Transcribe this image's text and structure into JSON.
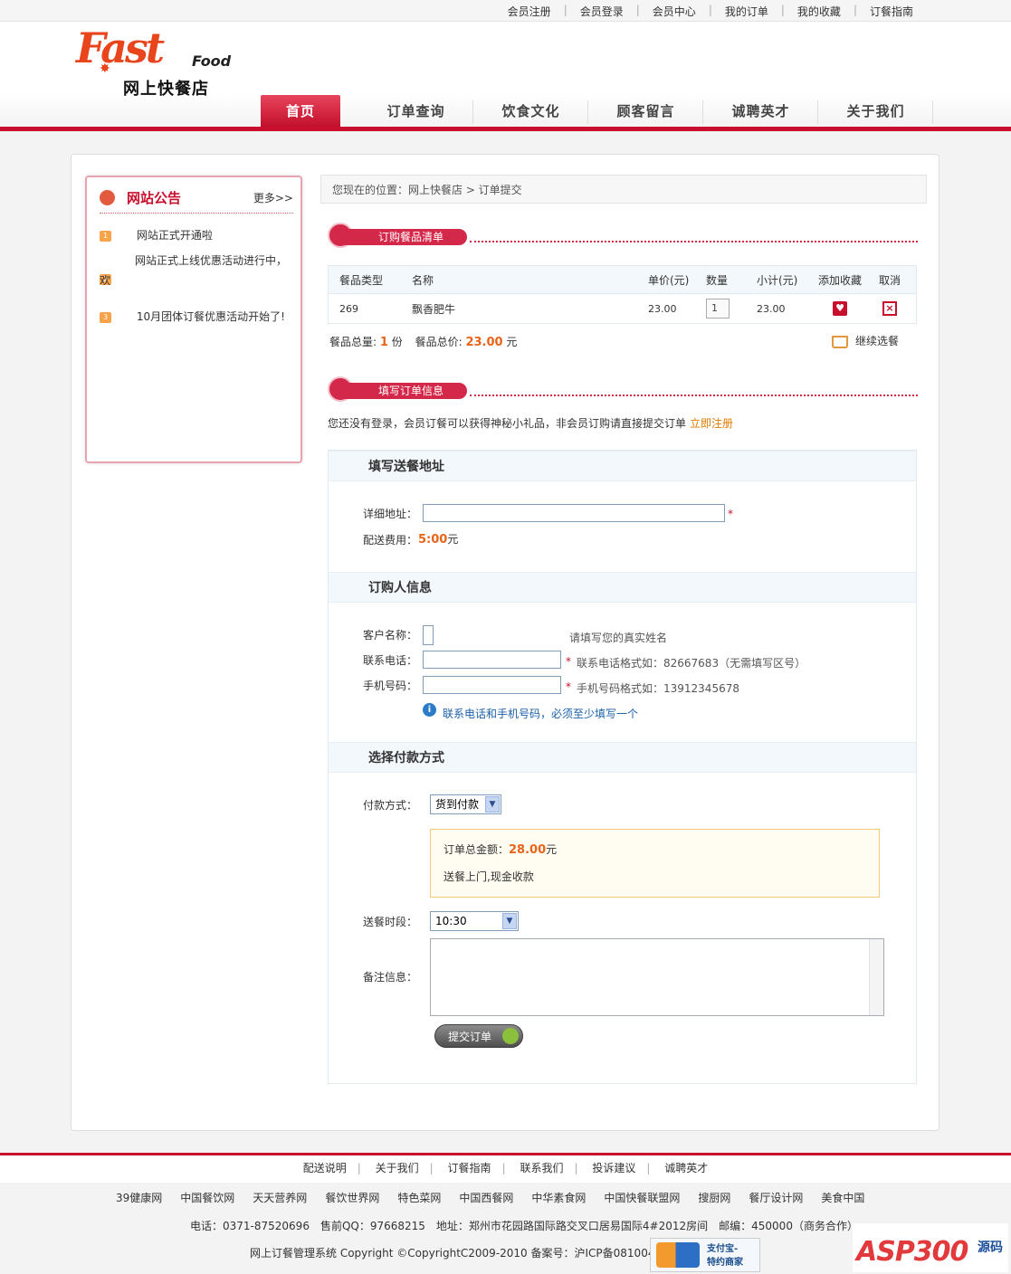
{
  "top_links": [
    "会员注册",
    "会员登录",
    "会员中心",
    "我的订单",
    "我的收藏",
    "订餐指南"
  ],
  "logo": {
    "brand_top": "Fast",
    "brand_food": "Food",
    "brand_cn": "网上快餐店"
  },
  "nav": [
    "首页",
    "订单查询",
    "饮食文化",
    "顾客留言",
    "诚聘英才",
    "关于我们"
  ],
  "notice": {
    "title": "网站公告",
    "more": "更多>>",
    "items": [
      {
        "num": "1",
        "text": "网站正式开通啦"
      },
      {
        "num": "2",
        "text": "网站正式上线优惠活动进行中，",
        "text2": "欢"
      },
      {
        "num": "3",
        "text": "10月团体订餐优惠活动开始了!"
      }
    ]
  },
  "breadcrumb": "您现在的位置：网上快餐店 > 订单提交",
  "sections": {
    "cart": "订购餐品清单",
    "order": "填写订单信息"
  },
  "cart": {
    "headers": [
      "餐品类型",
      "名称",
      "单价(元)",
      "数量",
      "小计(元)",
      "添加收藏",
      "取消"
    ],
    "rows": [
      {
        "type": "269",
        "name": "飘香肥牛",
        "price": "23.00",
        "qty": "1",
        "subtotal": "23.00"
      }
    ],
    "total_count_label": "餐品总量:",
    "total_count": "1",
    "total_count_unit": "份",
    "total_price_label": "餐品总价:",
    "total_price": "23.00",
    "total_price_unit": "元",
    "continue": "继续选餐"
  },
  "login_tip": {
    "text": "您还没有登录，会员订餐可以获得神秘小礼品，非会员订购请直接提交订单",
    "link": "立即注册"
  },
  "address": {
    "title": "填写送餐地址",
    "detail_label": "详细地址：",
    "detail_value": "",
    "fee_label": "配送费用：",
    "fee": "5:00",
    "fee_unit": "元"
  },
  "buyer": {
    "title": "订购人信息",
    "name_label": "客户名称：",
    "name_hint": "请填写您的真实姓名",
    "phone_label": "联系电话：",
    "phone_hint": "联系电话格式如：82667683（无需填写区号）",
    "mobile_label": "手机号码：",
    "mobile_hint": "手机号码格式如：13912345678",
    "info": "联系电话和手机号码，必须至少填写一个"
  },
  "payment": {
    "title": "选择付款方式",
    "method_label": "付款方式：",
    "method": "货到付款",
    "total_label": "订单总金额：",
    "total": "28.00",
    "total_unit": "元",
    "desc": "送餐上门,现金收款",
    "time_label": "送餐时段：",
    "time": "10:30",
    "note_label": "备注信息：",
    "submit": "提交订单"
  },
  "footer": {
    "links": [
      "配送说明",
      "关于我们",
      "订餐指南",
      "联系我们",
      "投诉建议",
      "诚聘英才"
    ],
    "friends": [
      "39健康网",
      "中国餐饮网",
      "天天营养网",
      "餐饮世界网",
      "特色菜网",
      "中国西餐网",
      "中华素食网",
      "中国快餐联盟网",
      "搜厨网",
      "餐厅设计网",
      "美食中国"
    ],
    "contact": "电话：0371-87520696　售前QQ：97668215　地址：郑州市花园路国际路交叉口居易国际4#2012房间　邮编：450000（商务合作）",
    "copyright": "网上订餐管理系统 Copyright ©CopyrightC2009-2010 备案号：沪ICP备08100465号",
    "alipay_line1": "支付宝-",
    "alipay_line2": "特约商家",
    "asp_logo": "ASP300",
    "asp_logo_cn": "源码"
  },
  "colors": {
    "brand": "#c8102e",
    "accent_orange": "#e8641a",
    "link_blue": "#1a5fa8"
  }
}
